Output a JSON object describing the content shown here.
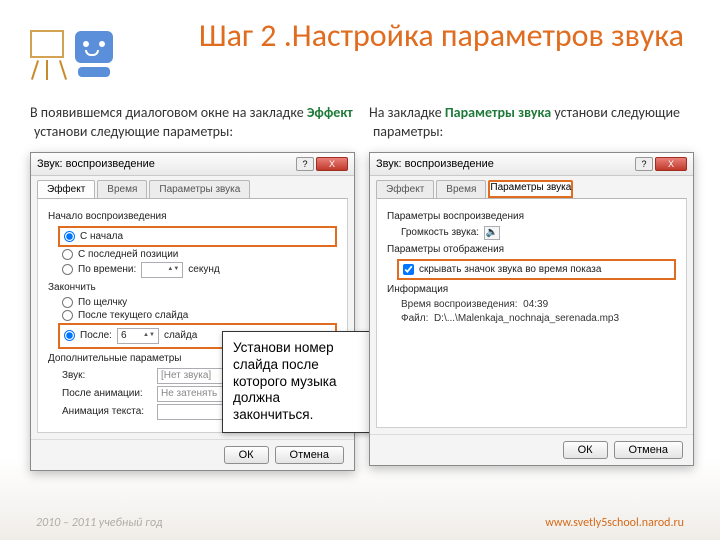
{
  "title": "Шаг 2 .Настройка параметров звука",
  "left": {
    "text_before": "В появившемся диалоговом окне на закладке ",
    "keyword": "Эффект",
    "text_after": " установи следующие параметры:"
  },
  "right": {
    "text_before": "На закладке ",
    "keyword": "Параметры звука",
    "text_after": " установи следующие параметры:"
  },
  "dialog": {
    "title": "Звук: воспроизведение",
    "tabs": [
      "Эффект",
      "Время",
      "Параметры звука"
    ],
    "group_start": "Начало воспроизведения",
    "rb_start": "С начала",
    "rb_lastpos": "С последней позиции",
    "rb_time": "По времени:",
    "seconds": "секунд",
    "group_end": "Закончить",
    "rb_click": "По щелчку",
    "rb_curslide": "После текущего слайда",
    "rb_after": "После:",
    "after_value": "6",
    "after_unit": "слайда",
    "group_extra": "Дополнительные параметры",
    "lbl_sound": "Звук:",
    "combo_sound": "[Нет звука]",
    "lbl_afteranim": "После анимации:",
    "combo_afteranim": "Не затенять",
    "lbl_animtext": "Анимация текста:",
    "ok": "ОК",
    "cancel": "Отмена"
  },
  "dialog2": {
    "group_play": "Параметры воспроизведения",
    "lbl_volume": "Громкость звука:",
    "group_disp": "Параметры отображения",
    "cb_hide": "скрывать значок звука во время показа",
    "group_info": "Информация",
    "lbl_duration": "Время воспроизведения:",
    "duration": "04:39",
    "lbl_file": "Файл:",
    "file": "D:\\...\\Malenkaja_nochnaja_serenada.mp3"
  },
  "callout": "Установи номер слайда после которого музыка должна закончиться.",
  "footer": {
    "year": "2010 – 2011 учебный год",
    "link": "www.svetly5school.narod.ru"
  }
}
